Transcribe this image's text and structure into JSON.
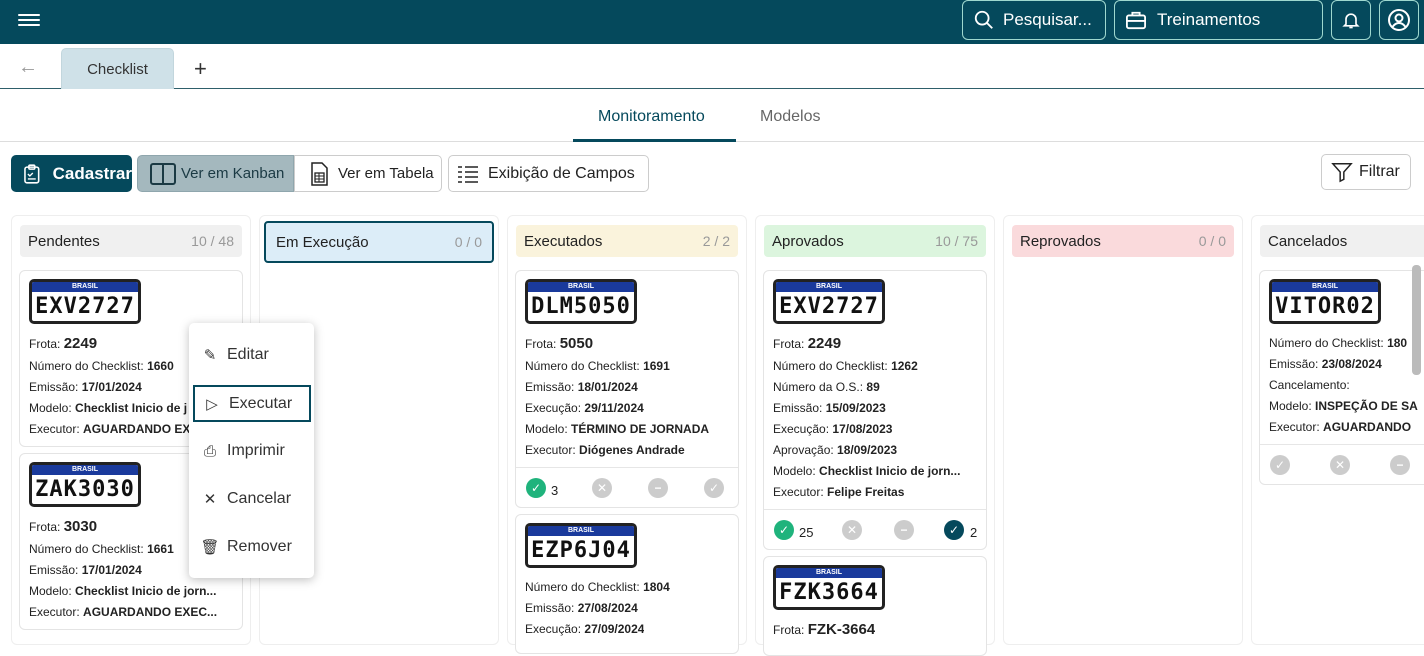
{
  "header": {
    "search_label": "Pesquisar...",
    "trainings_label": "Treinamentos"
  },
  "tabs": {
    "active": "Checklist",
    "add": "+",
    "back": "←"
  },
  "subtabs": {
    "monitoring": "Monitoramento",
    "models": "Modelos"
  },
  "toolbar": {
    "register": "Cadastrar",
    "kanban": "Ver em Kanban",
    "table": "Ver em Tabela",
    "fields": "Exibição de Campos",
    "filter": "Filtrar"
  },
  "columns": [
    {
      "title": "Pendentes",
      "count": "10 / 48",
      "color": "#f0f0f0"
    },
    {
      "title": "Em Execução",
      "count": "0 / 0",
      "color": "#dcedf8"
    },
    {
      "title": "Executados",
      "count": "2 / 2",
      "color": "#faf3dc"
    },
    {
      "title": "Aprovados",
      "count": "10 / 75",
      "color": "#dcf5de"
    },
    {
      "title": "Reprovados",
      "count": "0 / 0",
      "color": "#fadadc"
    },
    {
      "title": "Cancelados",
      "count": "",
      "color": "#f0f0f0"
    }
  ],
  "cards": {
    "p1": {
      "plate": "EXV2727",
      "brasil": "BRASIL",
      "frota_label": "Frota:",
      "frota": "2249",
      "l1k": "Número do Checklist:",
      "l1v": "1660",
      "l2k": "Emissão:",
      "l2v": "17/01/2024",
      "l3k": "Modelo:",
      "l3v": "Checklist Inicio de j",
      "l4k": "Executor:",
      "l4v": "AGUARDANDO EX"
    },
    "p2": {
      "plate": "ZAK3030",
      "brasil": "BRASIL",
      "frota_label": "Frota:",
      "frota": "3030",
      "l1k": "Número do Checklist:",
      "l1v": "1661",
      "l2k": "Emissão:",
      "l2v": "17/01/2024",
      "l3k": "Modelo:",
      "l3v": "Checklist Inicio de jorn...",
      "l4k": "Executor:",
      "l4v": "AGUARDANDO EXEC..."
    },
    "e1": {
      "plate": "DLM5050",
      "brasil": "BRASIL",
      "frota_label": "Frota:",
      "frota": "5050",
      "l1k": "Número do Checklist:",
      "l1v": "1691",
      "l2k": "Emissão:",
      "l2v": "18/01/2024",
      "l3k": "Execução:",
      "l3v": "29/11/2024",
      "l4k": "Modelo:",
      "l4v": "TÉRMINO DE JORNADA",
      "l5k": "Executor:",
      "l5v": "Diógenes Andrade",
      "ok": "3"
    },
    "e2": {
      "plate": "EZP6J04",
      "brasil": "BRASIL",
      "l1k": "Número do Checklist:",
      "l1v": "1804",
      "l2k": "Emissão:",
      "l2v": "27/08/2024",
      "l3k": "Execução:",
      "l3v": "27/09/2024"
    },
    "a1": {
      "plate": "EXV2727",
      "brasil": "BRASIL",
      "frota_label": "Frota:",
      "frota": "2249",
      "l1k": "Número do Checklist:",
      "l1v": "1262",
      "l2k": "Número da O.S.:",
      "l2v": "89",
      "l3k": "Emissão:",
      "l3v": "15/09/2023",
      "l4k": "Execução:",
      "l4v": "17/08/2023",
      "l5k": "Aprovação:",
      "l5v": "18/09/2023",
      "l6k": "Modelo:",
      "l6v": "Checklist Inicio de jorn...",
      "l7k": "Executor:",
      "l7v": "Felipe Freitas",
      "ok": "25",
      "approved": "2"
    },
    "a2": {
      "plate": "FZK3664",
      "brasil": "BRASIL",
      "frota_label": "Frota:",
      "frota": "FZK-3664"
    },
    "c1": {
      "plate": "VITOR02",
      "brasil": "BRASIL",
      "l1k": "Número do Checklist:",
      "l1v": "180",
      "l2k": "Emissão:",
      "l2v": "23/08/2024",
      "l3k": "Cancelamento:",
      "l3v": "",
      "l4k": "Modelo:",
      "l4v": "INSPEÇÃO DE SA",
      "l5k": "Executor:",
      "l5v": "AGUARDANDO"
    }
  },
  "context_menu": {
    "edit": "Editar",
    "execute": "Executar",
    "print": "Imprimir",
    "cancel": "Cancelar",
    "remove": "Remover"
  }
}
